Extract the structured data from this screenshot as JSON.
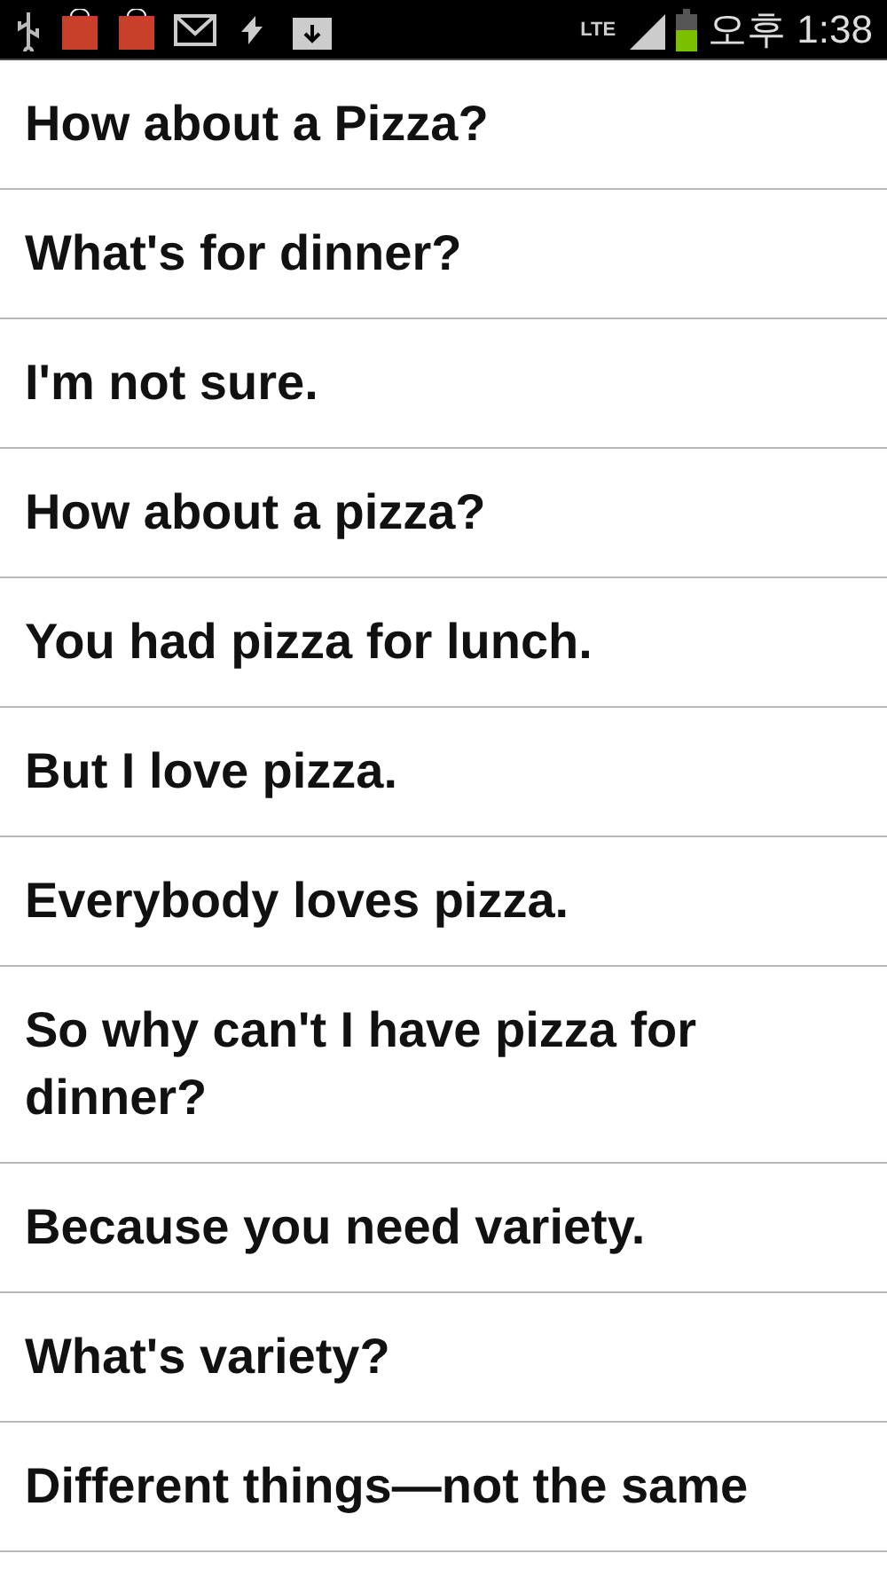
{
  "status_bar": {
    "network": "LTE",
    "time": "오후 1:38"
  },
  "items": [
    {
      "text": "How about a Pizza?"
    },
    {
      "text": "What's for dinner?"
    },
    {
      "text": "I'm not sure."
    },
    {
      "text": "How about a pizza?"
    },
    {
      "text": "You had pizza for lunch."
    },
    {
      "text": "But I love pizza."
    },
    {
      "text": "Everybody loves pizza."
    },
    {
      "text": "So why can't I have pizza for dinner?"
    },
    {
      "text": "Because you need variety."
    },
    {
      "text": "What's variety?"
    },
    {
      "text": "Different things—not the same"
    }
  ]
}
